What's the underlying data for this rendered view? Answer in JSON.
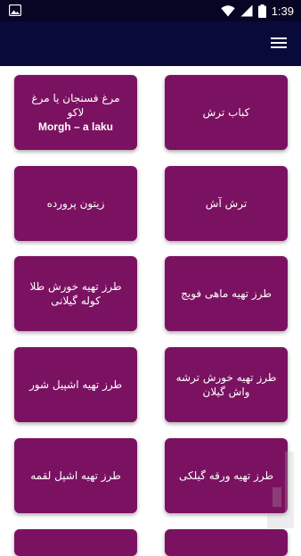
{
  "status_bar": {
    "time": "1:39",
    "icons": [
      "image-notification-icon",
      "wifi-icon",
      "signal-icon",
      "battery-icon"
    ]
  },
  "app_bar": {
    "menu_icon": "hamburger-menu-icon"
  },
  "colors": {
    "status_bar": "#060624",
    "app_bar": "#0a0a3a",
    "card": "#7b1261",
    "text": "#ffffff"
  },
  "cards": [
    {
      "title": "کباب ترش"
    },
    {
      "title": "مرغ فسنجان یا مرغ لاکو",
      "subtitle": "Morgh – a laku"
    },
    {
      "title": "ترش آش"
    },
    {
      "title": "زیتون پرورده"
    },
    {
      "title": "طرز تهیه ماهی فویج"
    },
    {
      "title": "طرز تهیه خورش طلا کوله گیلانی"
    },
    {
      "title": "طرز تهیه خورش ترشه واش گیلان"
    },
    {
      "title": "طرز تهیه اشپیل شور"
    },
    {
      "title": "طرز تهیه ورقه گیلکی"
    },
    {
      "title": "طرز تهیه اشپل لقمه"
    }
  ]
}
